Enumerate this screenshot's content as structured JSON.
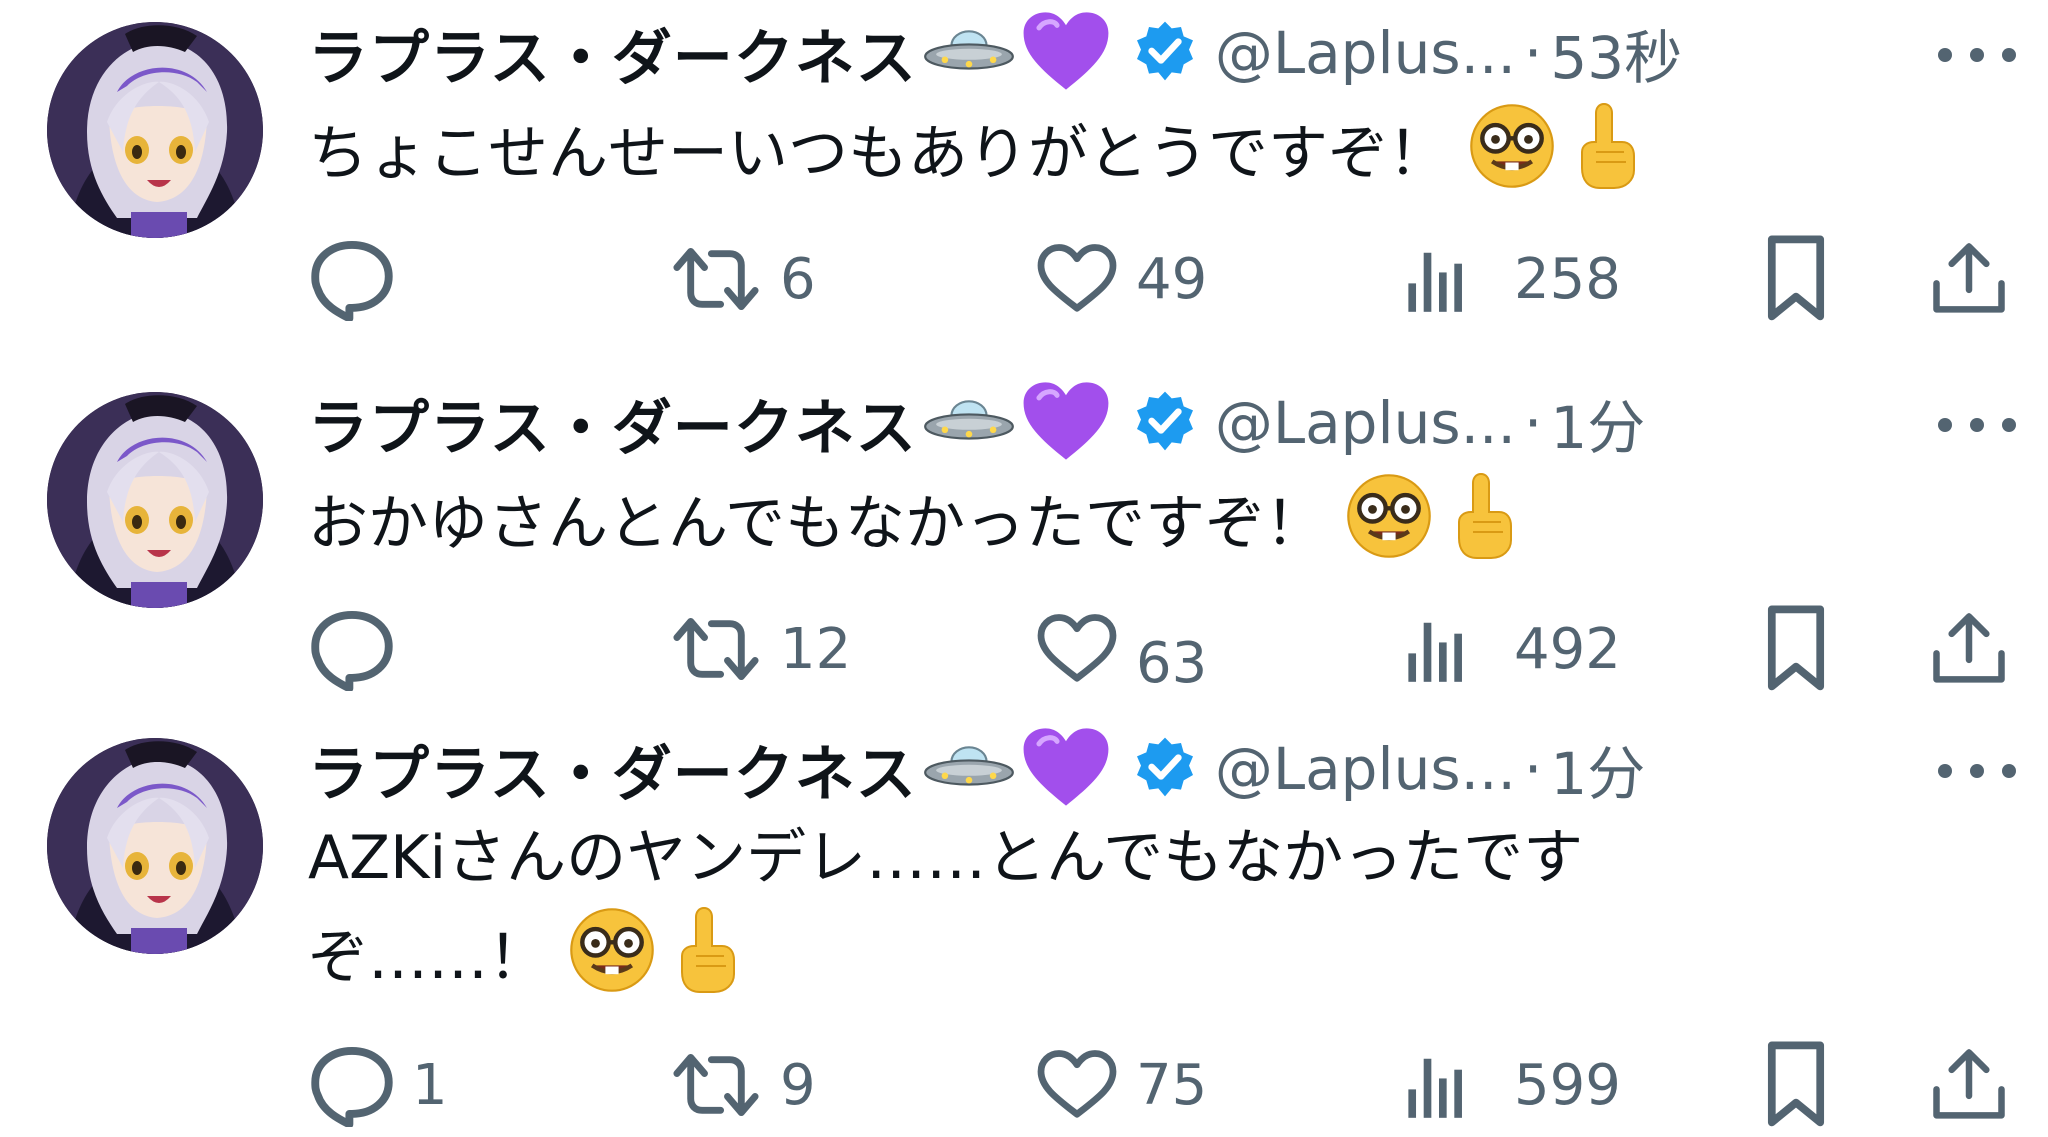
{
  "colors": {
    "text": "#0f1419",
    "secondary": "#536471",
    "verified": "#1d9bf0",
    "heart_emoji": "#a64ff0"
  },
  "tweets": [
    {
      "name": "ラプラス・ダークネス",
      "name_emojis": [
        "ufo-icon",
        "purple-heart-icon"
      ],
      "handle": "@Laplus...",
      "separator": "·",
      "time": "53秒",
      "text": "ちょこせんせーいつもありがとうですぞ！",
      "text_emojis": [
        "nerd-face-icon",
        "index-pointing-up-icon"
      ],
      "reply_count": "",
      "retweet_count": "6",
      "like_count": "49",
      "view_count": "258"
    },
    {
      "name": "ラプラス・ダークネス",
      "name_emojis": [
        "ufo-icon",
        "purple-heart-icon"
      ],
      "handle": "@Laplus...",
      "separator": "·",
      "time": "1分",
      "text": "おかゆさんとんでもなかったですぞ！",
      "text_emojis": [
        "nerd-face-icon",
        "index-pointing-up-icon"
      ],
      "reply_count": "",
      "retweet_count": "12",
      "like_count": "63",
      "view_count": "492"
    },
    {
      "name": "ラプラス・ダークネス",
      "name_emojis": [
        "ufo-icon",
        "purple-heart-icon"
      ],
      "handle": "@Laplus...",
      "separator": "·",
      "time": "1分",
      "text_line1": "AZKiさんのヤンデレ……とんでもなかったです",
      "text_line2": "ぞ……！",
      "text_emojis": [
        "nerd-face-icon",
        "index-pointing-up-icon"
      ],
      "reply_count": "1",
      "retweet_count": "9",
      "like_count": "75",
      "view_count": "599"
    }
  ]
}
